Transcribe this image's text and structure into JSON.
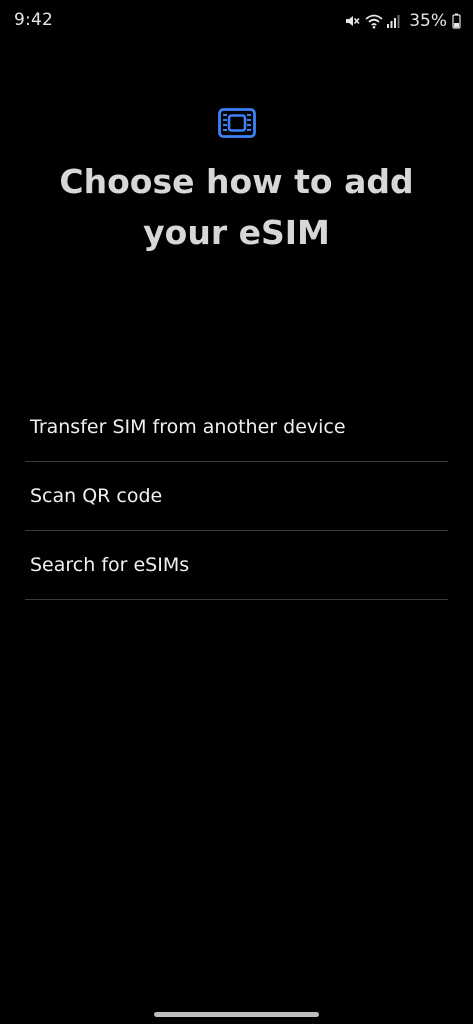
{
  "status_bar": {
    "time": "9:42",
    "battery_percent": "35%",
    "icons": [
      "mute-icon",
      "wifi-icon",
      "signal-icon",
      "battery-icon"
    ]
  },
  "header": {
    "icon": "sim-card-icon",
    "icon_color": "#3b82f6",
    "title": "Choose how to add your eSIM"
  },
  "options": [
    {
      "label": "Transfer SIM from another device"
    },
    {
      "label": "Scan QR code"
    },
    {
      "label": "Search for eSIMs"
    }
  ],
  "colors": {
    "background": "#000000",
    "accent": "#3b82f6",
    "divider": "#3a3a3a"
  }
}
